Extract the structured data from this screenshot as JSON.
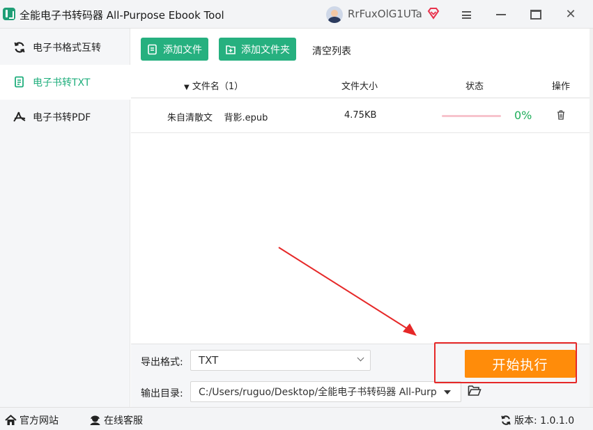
{
  "window": {
    "title": "全能电子书转码器 All-Purpose Ebook Tool",
    "username": "RrFuxOlG1UTa"
  },
  "sidebar": {
    "items": [
      {
        "label": "电子书格式互转",
        "icon": "refresh-icon",
        "active": false
      },
      {
        "label": "电子书转TXT",
        "icon": "document-icon",
        "active": true
      },
      {
        "label": "电子书转PDF",
        "icon": "pdf-icon",
        "active": false
      }
    ]
  },
  "toolbar": {
    "add_file": "添加文件",
    "add_folder": "添加文件夹",
    "clear_list": "清空列表"
  },
  "table": {
    "columns": {
      "name": "文件名（1）",
      "size": "文件大小",
      "status": "状态",
      "op": "操作"
    },
    "rows": [
      {
        "name": "朱自清散文    背影.epub",
        "size": "4.75KB",
        "progress_percent": 0,
        "status": "0%"
      }
    ]
  },
  "settings": {
    "format_label": "导出格式:",
    "format_value": "TXT",
    "dir_label": "输出目录:",
    "dir_value": "C:/Users/ruguo/Desktop/全能电子书转码器 All-Purp"
  },
  "actions": {
    "start": "开始执行"
  },
  "footer": {
    "site": "官方网站",
    "service": "在线客服",
    "version": "版本: 1.0.1.0"
  },
  "colors": {
    "brand_green": "#26b07f",
    "start_orange": "#ff8c0a",
    "annotation_red": "#e62828",
    "progress_track": "#f7c3cc",
    "percent_green": "#1fae5b"
  }
}
